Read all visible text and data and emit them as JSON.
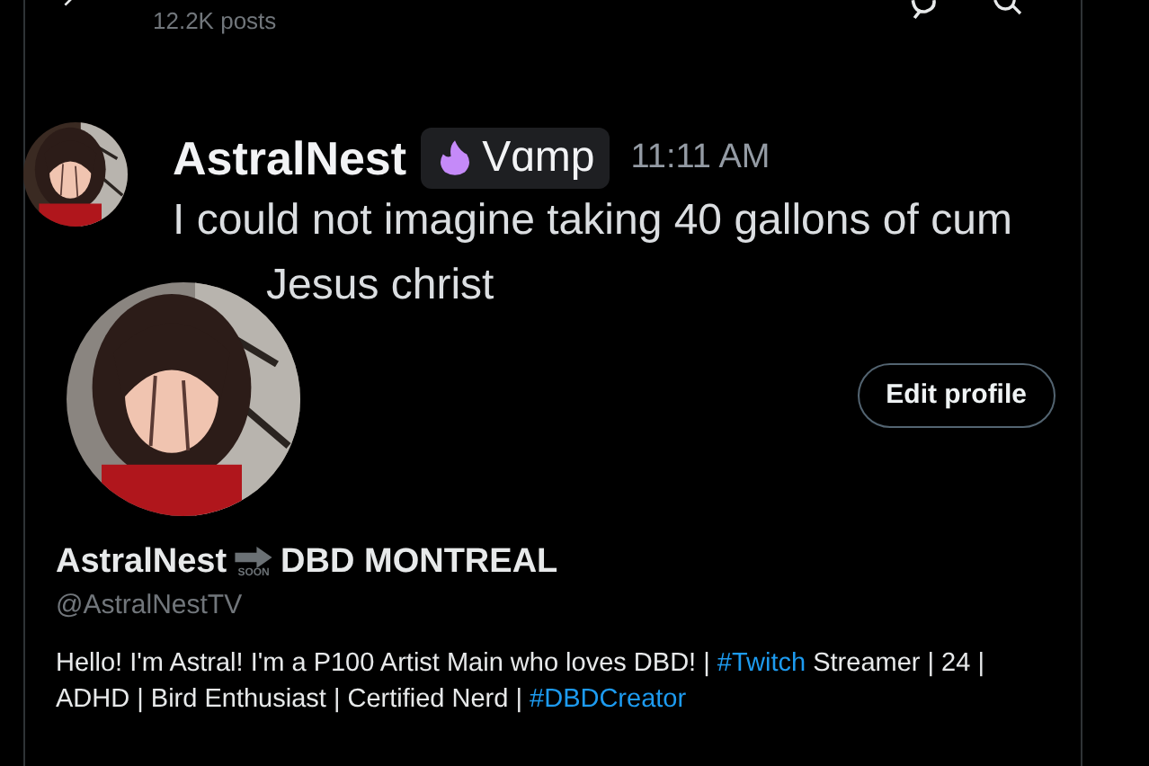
{
  "header": {
    "post_count": "12.2K posts"
  },
  "banner": {
    "message": {
      "author": "AstralNest",
      "tag": "Vɑmp",
      "time": "11:11 AM",
      "lines": [
        "I could not imagine taking 40 gallons of cum",
        "Jesus christ"
      ]
    }
  },
  "profile": {
    "edit_button": "Edit profile",
    "name": "AstralNest",
    "arrow_label": "SOON",
    "name_suffix": "DBD MONTREAL",
    "handle": "@AstralNestTV",
    "bio": [
      {
        "kind": "text",
        "text": "Hello! I'm Astral! I'm a P100 Artist Main who loves DBD! | "
      },
      {
        "kind": "hashtag",
        "text": "#Twitch"
      },
      {
        "kind": "text",
        "text": " Streamer | 24 | ADHD | Bird Enthusiast | Certified Nerd | "
      },
      {
        "kind": "hashtag",
        "text": "#DBDCreator"
      }
    ]
  }
}
